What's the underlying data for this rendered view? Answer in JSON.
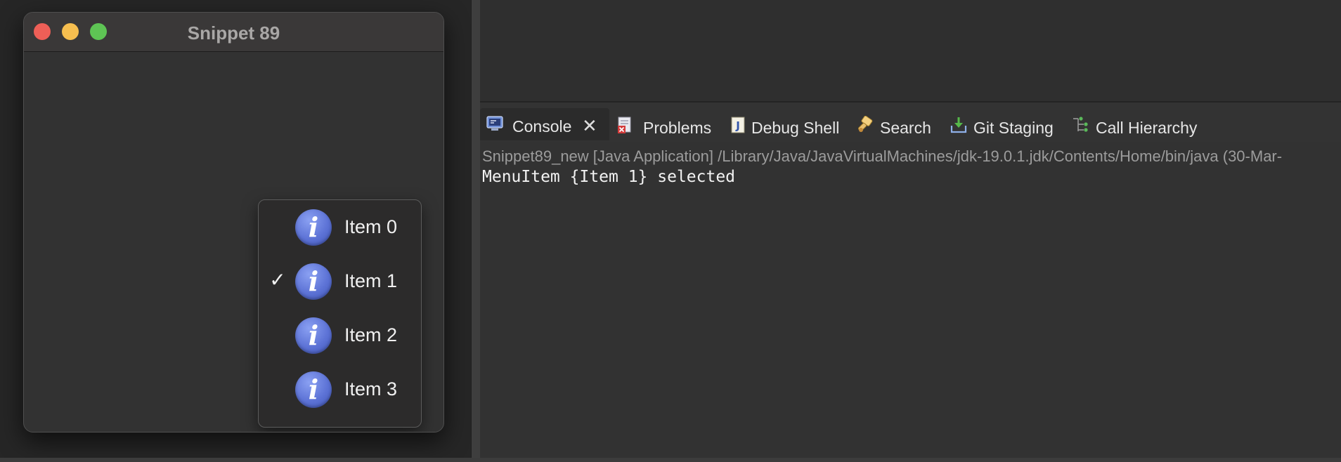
{
  "window": {
    "title": "Snippet 89",
    "traffic_lights": [
      "close",
      "minimize",
      "zoom"
    ]
  },
  "popup_menu": {
    "items": [
      {
        "label": "Item 0",
        "checked": false,
        "icon": "info-icon"
      },
      {
        "label": "Item 1",
        "checked": true,
        "icon": "info-icon"
      },
      {
        "label": "Item 2",
        "checked": false,
        "icon": "info-icon"
      },
      {
        "label": "Item 3",
        "checked": false,
        "icon": "info-icon"
      }
    ],
    "check_glyph": "✓",
    "icon_glyph": "i"
  },
  "ide": {
    "tabs": [
      {
        "label": "Console",
        "icon": "console-icon",
        "active": true,
        "close": "✕"
      },
      {
        "label": "Problems",
        "icon": "problems-icon"
      },
      {
        "label": "Debug Shell",
        "icon": "debug-shell-icon"
      },
      {
        "label": "Search",
        "icon": "search-icon"
      },
      {
        "label": "Git Staging",
        "icon": "git-staging-icon"
      },
      {
        "label": "Call Hierarchy",
        "icon": "call-hierarchy-icon"
      }
    ],
    "console": {
      "header": "Snippet89_new [Java Application] /Library/Java/JavaVirtualMachines/jdk-19.0.1.jdk/Contents/Home/bin/java  (30-Mar-",
      "output": "MenuItem {Item 1} selected"
    }
  },
  "colors": {
    "close": "#ee5f57",
    "minimize": "#f6be4f",
    "zoom": "#5ec454",
    "info_icon": "#5d73d6"
  }
}
